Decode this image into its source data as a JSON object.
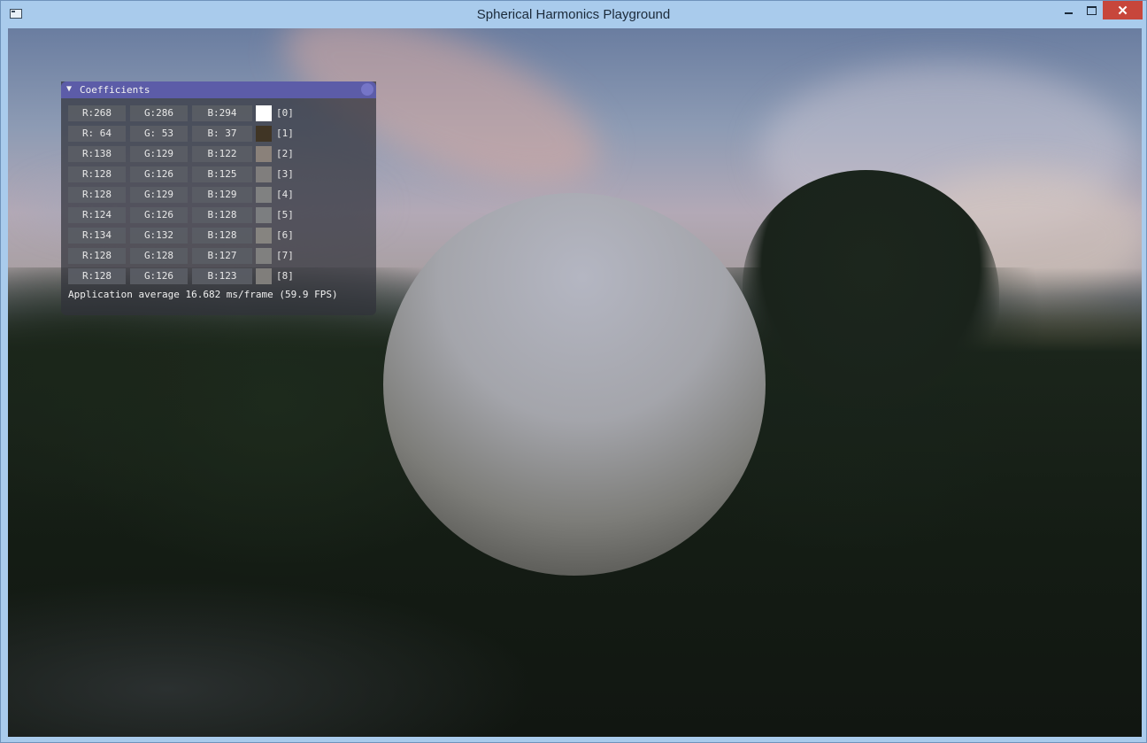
{
  "window": {
    "title": "Spherical Harmonics Playground",
    "close_glyph": "✕"
  },
  "panel": {
    "title": "Coefficients",
    "collapse_glyph": "▼",
    "rows": [
      {
        "r": "R:268",
        "g": "G:286",
        "b": "B:294",
        "index": "[0]",
        "swatch": "#ffffff"
      },
      {
        "r": "R: 64",
        "g": "G: 53",
        "b": "B: 37",
        "index": "[1]",
        "swatch": "#403525"
      },
      {
        "r": "R:138",
        "g": "G:129",
        "b": "B:122",
        "index": "[2]",
        "swatch": "#8a817a"
      },
      {
        "r": "R:128",
        "g": "G:126",
        "b": "B:125",
        "index": "[3]",
        "swatch": "#807e7d"
      },
      {
        "r": "R:128",
        "g": "G:129",
        "b": "B:129",
        "index": "[4]",
        "swatch": "#808181"
      },
      {
        "r": "R:124",
        "g": "G:126",
        "b": "B:128",
        "index": "[5]",
        "swatch": "#7c7e80"
      },
      {
        "r": "R:134",
        "g": "G:132",
        "b": "B:128",
        "index": "[6]",
        "swatch": "#868480"
      },
      {
        "r": "R:128",
        "g": "G:128",
        "b": "B:127",
        "index": "[7]",
        "swatch": "#80807f"
      },
      {
        "r": "R:128",
        "g": "G:126",
        "b": "B:123",
        "index": "[8]",
        "swatch": "#807e7b"
      }
    ],
    "fps_text": "Application average 16.682 ms/frame (59.9 FPS)"
  },
  "colors": {
    "title_bar": "#5c5ca8",
    "window_chrome": "#a9cbec",
    "close_button": "#c7463b",
    "sphere": "#a4a5ab"
  },
  "icons": {
    "app": "app-window-icon",
    "minimize": "minimize-icon",
    "maximize": "maximize-icon",
    "close": "close-icon"
  }
}
